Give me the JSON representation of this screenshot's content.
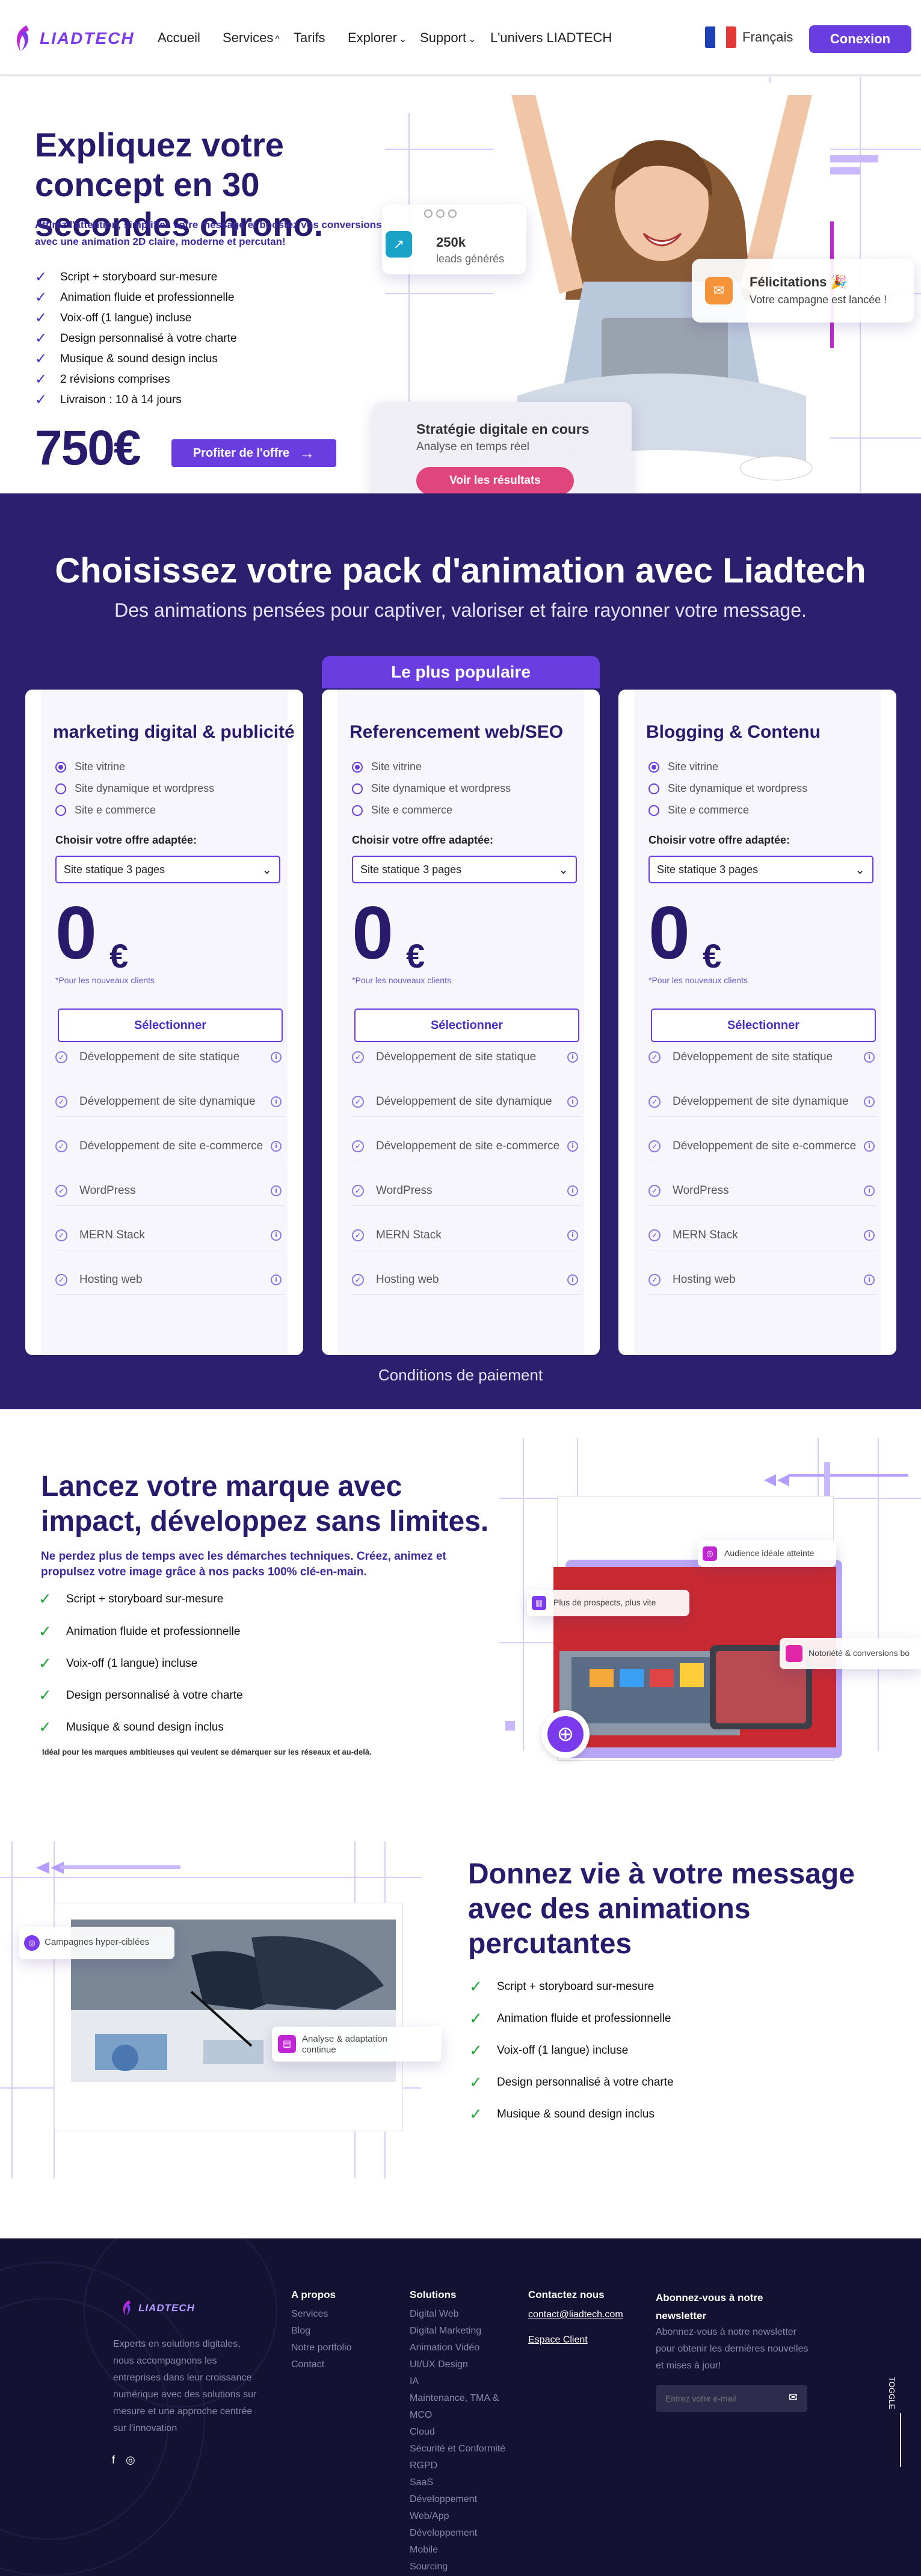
{
  "nav": {
    "logo": "LIADTECH",
    "links": [
      "Accueil",
      "Services",
      "Tarifs",
      "Explorer",
      "Support",
      "L'univers LIADTECH"
    ],
    "lang": "Français",
    "login": "Conexion"
  },
  "hero": {
    "title": "Expliquez votre concept en 30 secondes chrono.",
    "subtitle": "Attirez l'attention, simplifiez votre message et boostez vos conversions avec une animation 2D claire, moderne et percutan!",
    "features": [
      "Script + storyboard sur-mesure",
      "Animation fluide et professionnelle",
      "Voix-off (1 langue) incluse",
      "Design personnalisé à votre charte",
      "Musique & sound design inclus",
      "2 révisions comprises",
      "Livraison : 10 à 14 jours"
    ],
    "price": "750€",
    "cta": "Profiter de l'offre",
    "stat_value": "250k",
    "stat_label": "leads générés",
    "congrats_title": "Félicitations 🎉",
    "congrats_text": "Votre campagne est lancée !",
    "strategy_title": "Stratégie digitale en cours",
    "strategy_sub": "Analyse en temps réel",
    "strategy_btn": "Voir les résultats"
  },
  "packs": {
    "title": "Choisissez votre pack d'animation avec Liadtech",
    "subtitle": "Des animations pensées pour captiver, valoriser et faire rayonner votre message.",
    "popular": "Le plus populaire",
    "cards": [
      {
        "title": "marketing digital & publicité"
      },
      {
        "title": "Referencement web/SEO"
      },
      {
        "title": "Blogging & Contenu"
      }
    ],
    "options": [
      "Site vitrine",
      "Site dynamique et wordpress",
      "Site e commerce"
    ],
    "choose_label": "Choisir votre offre adaptée:",
    "select_value": "Site statique 3 pages",
    "price_zero": "0",
    "currency": "€",
    "note": "*Pour les nouveaux clients",
    "select_btn": "Sélectionner",
    "features": [
      "Développement de site statique",
      "Développement de site dynamique",
      "Développement de site e-commerce",
      "WordPress",
      "MERN Stack",
      "Hosting web"
    ],
    "payment": "Conditions de paiement"
  },
  "launch": {
    "title": "Lancez votre marque avec impact, développez sans limites.",
    "subtitle": "Ne perdez plus de temps avec les démarches techniques. Créez, animez et propulsez votre image grâce à nos packs 100% clé-en-main.",
    "features": [
      "Script + storyboard sur-mesure",
      "Animation fluide et professionnelle",
      "Voix-off (1 langue) incluse",
      "Design personnalisé à votre charte",
      "Musique & sound design inclus"
    ],
    "note": "Idéal pour les marques ambitieuses qui veulent se démarquer sur les réseaux et au-delà.",
    "tag_audience": "Audience idéale atteinte",
    "tag_prospects": "Plus de prospects, plus vite",
    "tag_notoriete": "Notoriété & conversions bo"
  },
  "message": {
    "title": "Donnez vie à votre message avec des animations percutantes",
    "features": [
      "Script + storyboard sur-mesure",
      "Animation fluide et professionnelle",
      "Voix-off (1 langue) incluse",
      "Design personnalisé à votre charte",
      "Musique & sound design inclus"
    ],
    "tag_campaign": "Campagnes hyper-ciblées",
    "tag_analysis": "Analyse & adaptation continue"
  },
  "footer": {
    "logo": "LIADTECH",
    "about": "Experts en solutions digitales, nous accompagnons les entreprises dans leur croissance numérique avec des solutions sur mesure et une approche centrée sur l'innovation",
    "col1_title": "A propos",
    "col1": [
      "Services",
      "Blog",
      "Notre portfolio",
      "Contact"
    ],
    "col2_title": "Solutions",
    "col2": [
      "Digital Web",
      "Digital Marketing",
      "Animation Vidéo",
      "UI/UX Design",
      "IA",
      "Maintenance, TMA &",
      "MCO",
      "Cloud",
      "Sécurité et Conformité",
      "RGPD",
      "SaaS",
      "Développement",
      "Web/App",
      "Développement",
      "Mobile",
      "Sourcing"
    ],
    "col3_title": "Contactez nous",
    "email": "contact@liadtech.com",
    "client": "Espace Client",
    "col4_title": "Abonnez-vous à notre newsletter",
    "newsletter_text": "Abonnez-vous à notre newsletter pour obtenir les dernières nouvelles et mises à jour!",
    "email_placeholder": "Entrez votre e-mail",
    "toggle": "TOGGLE"
  },
  "colors": {
    "primary": "#6a3de0",
    "navy": "#2c1f6e",
    "title": "#2a1a6b",
    "footer": "#131232",
    "green": "#22a33a"
  }
}
